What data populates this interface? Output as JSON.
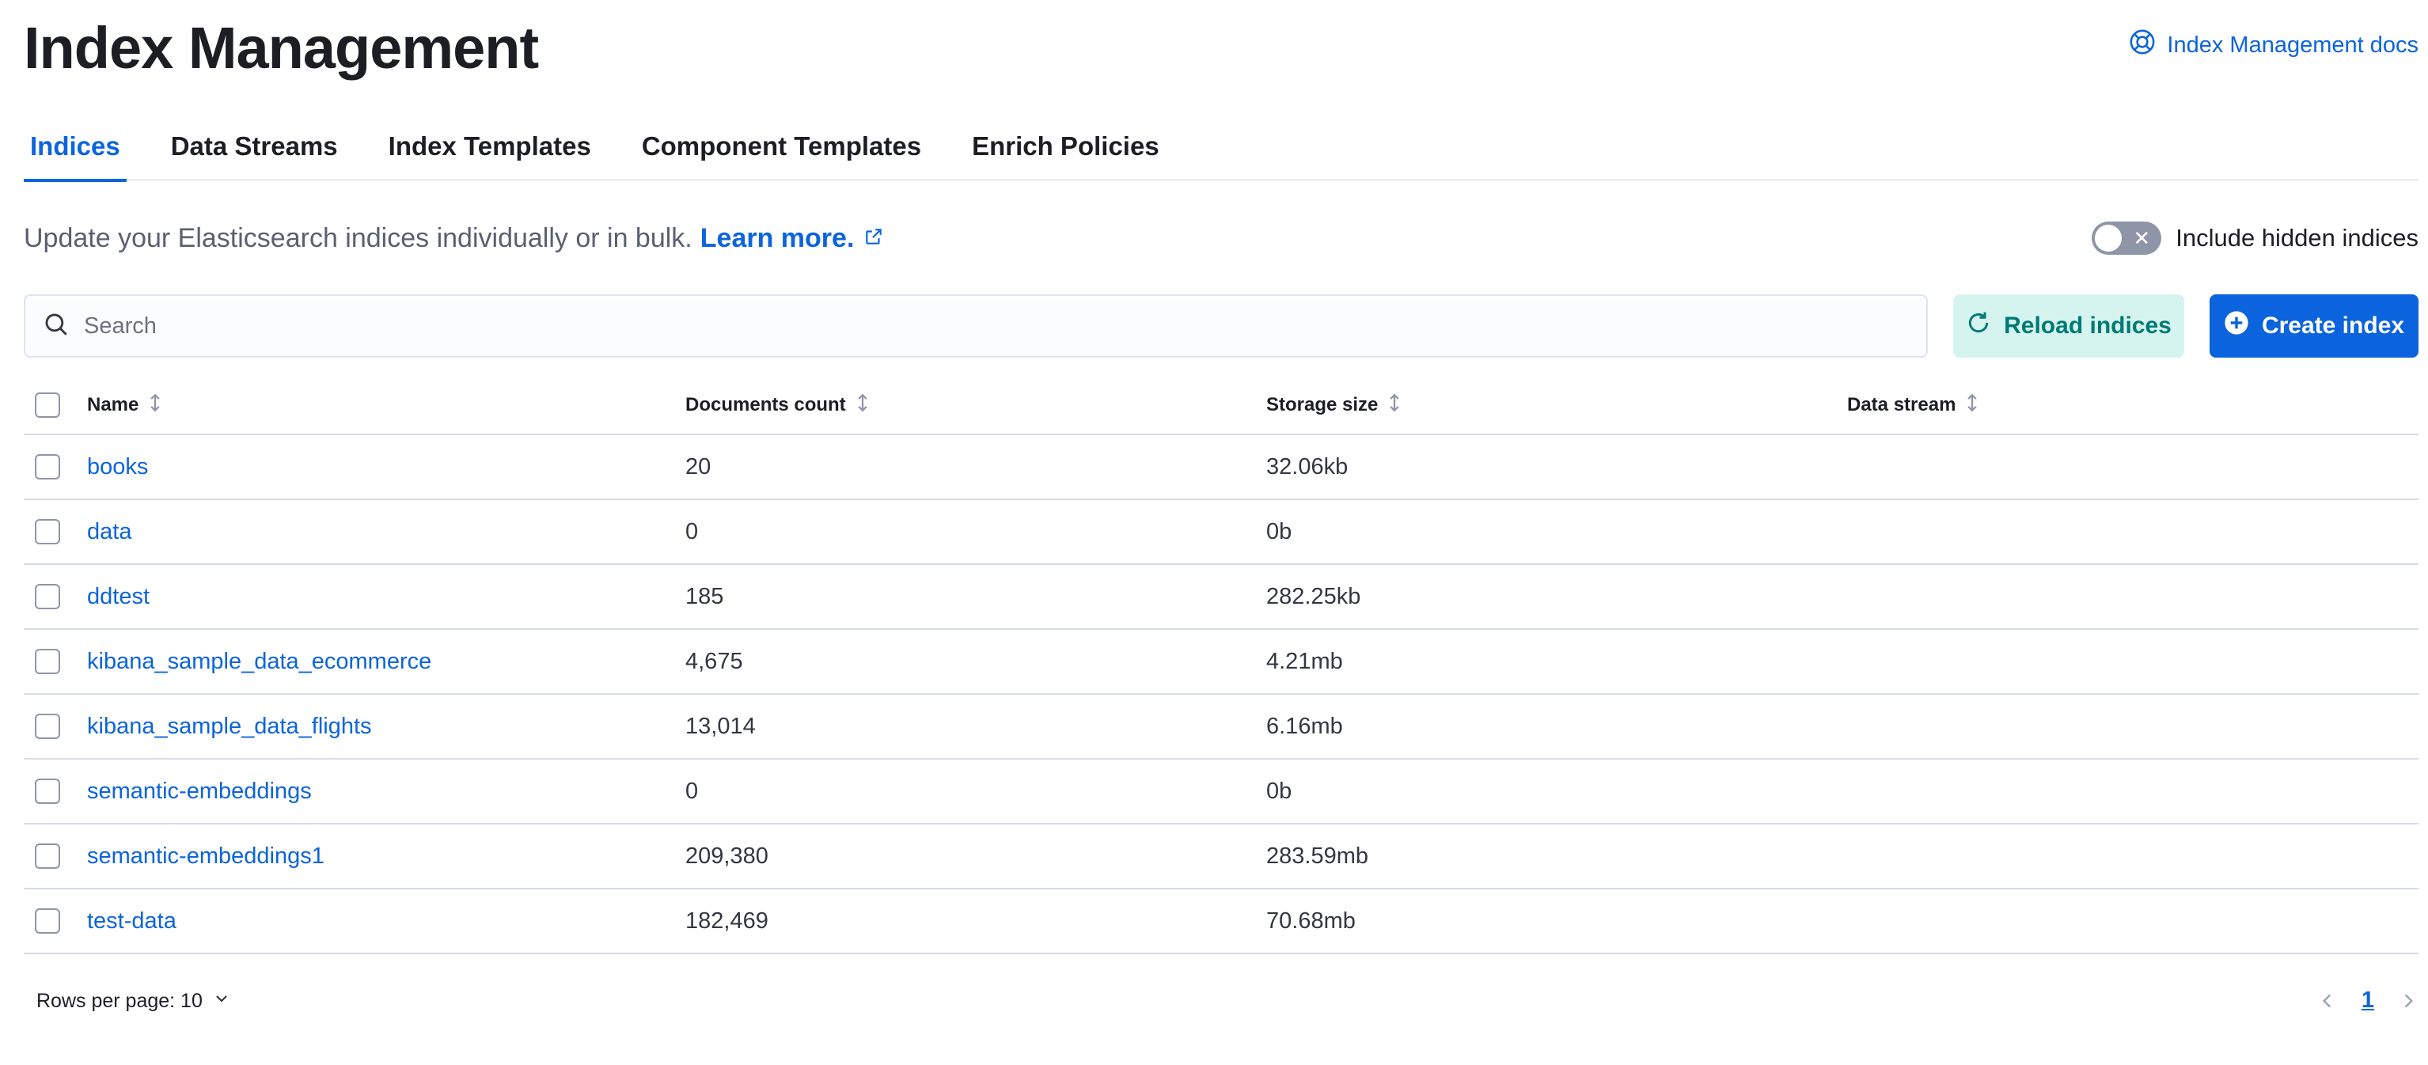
{
  "header": {
    "title": "Index Management",
    "docs_link": "Index Management docs"
  },
  "tabs": [
    {
      "label": "Indices",
      "active": true
    },
    {
      "label": "Data Streams",
      "active": false
    },
    {
      "label": "Index Templates",
      "active": false
    },
    {
      "label": "Component Templates",
      "active": false
    },
    {
      "label": "Enrich Policies",
      "active": false
    }
  ],
  "description": {
    "text": "Update your Elasticsearch indices individually or in bulk.",
    "link": "Learn more."
  },
  "hidden_toggle": {
    "label": "Include hidden indices",
    "checked": false
  },
  "search": {
    "placeholder": "Search",
    "value": ""
  },
  "buttons": {
    "reload": "Reload indices",
    "create": "Create index"
  },
  "table": {
    "columns": [
      "Name",
      "Documents count",
      "Storage size",
      "Data stream"
    ],
    "rows": [
      {
        "name": "books",
        "docs": "20",
        "size": "32.06kb",
        "stream": ""
      },
      {
        "name": "data",
        "docs": "0",
        "size": "0b",
        "stream": ""
      },
      {
        "name": "ddtest",
        "docs": "185",
        "size": "282.25kb",
        "stream": ""
      },
      {
        "name": "kibana_sample_data_ecommerce",
        "docs": "4,675",
        "size": "4.21mb",
        "stream": ""
      },
      {
        "name": "kibana_sample_data_flights",
        "docs": "13,014",
        "size": "6.16mb",
        "stream": ""
      },
      {
        "name": "semantic-embeddings",
        "docs": "0",
        "size": "0b",
        "stream": ""
      },
      {
        "name": "semantic-embeddings1",
        "docs": "209,380",
        "size": "283.59mb",
        "stream": ""
      },
      {
        "name": "test-data",
        "docs": "182,469",
        "size": "70.68mb",
        "stream": ""
      }
    ]
  },
  "footer": {
    "rows_per_page": "Rows per page: 10",
    "current_page": "1"
  },
  "colors": {
    "primary": "#0b64dd",
    "reload_bg": "#d5f4f0",
    "reload_text": "#007a73",
    "toggle_off": "#8e95a6"
  },
  "icons": {
    "docs": "help-lifebuoy-icon",
    "external": "external-link-icon",
    "search": "search-icon",
    "reload": "refresh-icon",
    "create": "plus-circle-icon",
    "sort": "sort-icon",
    "rows_menu": "chevron-down-icon",
    "prev": "chevron-left-icon",
    "next": "chevron-right-icon"
  }
}
